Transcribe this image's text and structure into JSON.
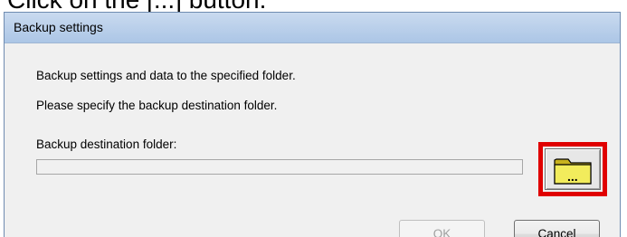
{
  "instruction": "Click on the [...] button.",
  "dialog": {
    "title": "Backup settings",
    "description_line1": "Backup settings and data to the specified folder.",
    "description_line2": "Please specify the backup destination folder.",
    "folder_label": "Backup destination folder:",
    "folder_path_value": "",
    "browse_icon": "folder-browse-icon",
    "browse_glyph": "...",
    "ok_label": "OK",
    "cancel_label": "Cancel",
    "ok_enabled": false
  },
  "colors": {
    "highlight": "#e00000",
    "title_bar": "#b9cfea",
    "dialog_background": "#f0f0f0",
    "folder_fill": "#f2ec5c"
  }
}
